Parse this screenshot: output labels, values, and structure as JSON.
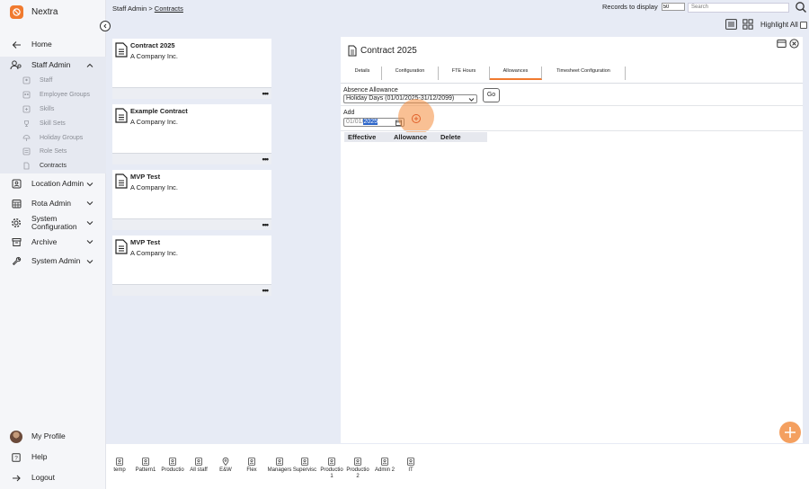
{
  "app": {
    "name": "Nextra",
    "logo_icon": "nextra-logo-icon",
    "accent": "#f07a2f"
  },
  "sidebar": {
    "items": [
      {
        "label": "Home",
        "icon": "arrow-left-icon"
      },
      {
        "label": "Staff Admin",
        "icon": "users-icon",
        "expanded": true
      },
      {
        "label": "Location Admin",
        "icon": "location-icon"
      },
      {
        "label": "Rota Admin",
        "icon": "calendar-icon"
      },
      {
        "label": "System Configuration",
        "icon": "gear-icon"
      },
      {
        "label": "Archive",
        "icon": "archive-icon"
      },
      {
        "label": "System Admin",
        "icon": "wrench-icon"
      }
    ],
    "staff_admin_sub": [
      {
        "label": "Staff"
      },
      {
        "label": "Employee Groups"
      },
      {
        "label": "Skills"
      },
      {
        "label": "Skill Sets"
      },
      {
        "label": "Holiday Groups"
      },
      {
        "label": "Role Sets"
      },
      {
        "label": "Contracts",
        "active": true
      }
    ],
    "bottom": [
      {
        "label": "My Profile",
        "icon": "avatar"
      },
      {
        "label": "Help",
        "icon": "help-icon"
      },
      {
        "label": "Logout",
        "icon": "logout-icon"
      }
    ]
  },
  "topbar": {
    "breadcrumb_root": "Staff Admin",
    "breadcrumb_sep": ">",
    "breadcrumb_current": "Contracts",
    "records_label": "Records to display",
    "records_value": "50",
    "search_placeholder": "Search",
    "highlight_label": "Highlight All"
  },
  "contracts": [
    {
      "title": "Contract 2025",
      "company": "A Company Inc."
    },
    {
      "title": "Example Contract",
      "company": "A Company Inc."
    },
    {
      "title": "MVP Test",
      "company": "A Company Inc."
    },
    {
      "title": "MVP Test",
      "company": "A Company Inc."
    }
  ],
  "card_menu": "•••",
  "detail": {
    "title": "Contract 2025",
    "tabs": [
      "Details",
      "Configuration",
      "FTE Hours",
      "Allowances",
      "Timesheet Configuration"
    ],
    "active_tab": "Allowances",
    "absence_label": "Absence Allowance",
    "absence_value": "Holiday Days (01/01/2025-31/12/2099)",
    "go_label": "Go",
    "add_label": "Add",
    "date_prefix": "01/01/",
    "date_selected": "2025",
    "columns": [
      "Effective",
      "Allowance",
      "Delete"
    ]
  },
  "bottombar": [
    {
      "label": "temp"
    },
    {
      "label": "Pattern1"
    },
    {
      "label": "Productio"
    },
    {
      "label": "All staff"
    },
    {
      "label": "E&W",
      "icon": "pin-icon"
    },
    {
      "label": "Flex"
    },
    {
      "label": "Managers"
    },
    {
      "label": "Supervisc"
    },
    {
      "label": "Productio 1"
    },
    {
      "label": "Productio 2"
    },
    {
      "label": "Admin 2"
    },
    {
      "label": "IT"
    }
  ]
}
